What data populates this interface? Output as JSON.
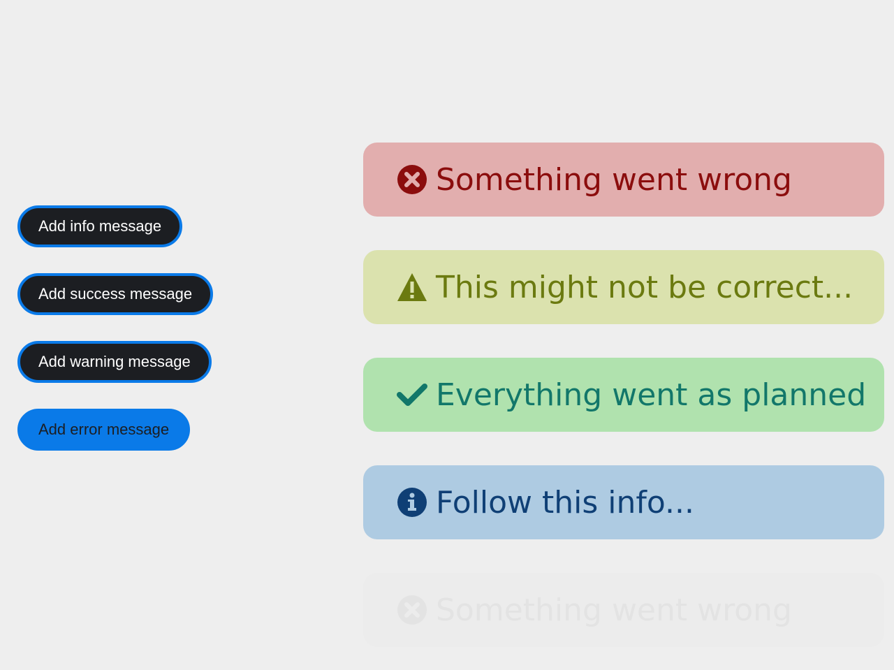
{
  "buttons": {
    "info": "Add info message",
    "success": "Add success message",
    "warning": "Add warning message",
    "error": "Add error message"
  },
  "toasts": [
    {
      "type": "error",
      "icon": "times-circle-icon",
      "text": "Something went wrong",
      "color": "#8b0d0d",
      "background": "#e2aeae"
    },
    {
      "type": "warning",
      "icon": "warning-triangle-icon",
      "text": "This might not be correct...",
      "color": "#6b7a10",
      "background": "#dbe2ae"
    },
    {
      "type": "success",
      "icon": "check-icon",
      "text": "Everything went as planned",
      "color": "#12776a",
      "background": "#b0e2ae"
    },
    {
      "type": "info",
      "icon": "info-circle-icon",
      "text": "Follow this info...",
      "color": "#0f3f75",
      "background": "#aecbe2"
    },
    {
      "type": "error",
      "icon": "times-circle-icon",
      "text": "Something went wrong",
      "color": "#e3e3e3",
      "background": "#ececec",
      "fading": true
    }
  ],
  "colors": {
    "page_background": "#eeeeee",
    "button_dark": "#1c1e22",
    "button_accent": "#0a7ae8"
  }
}
